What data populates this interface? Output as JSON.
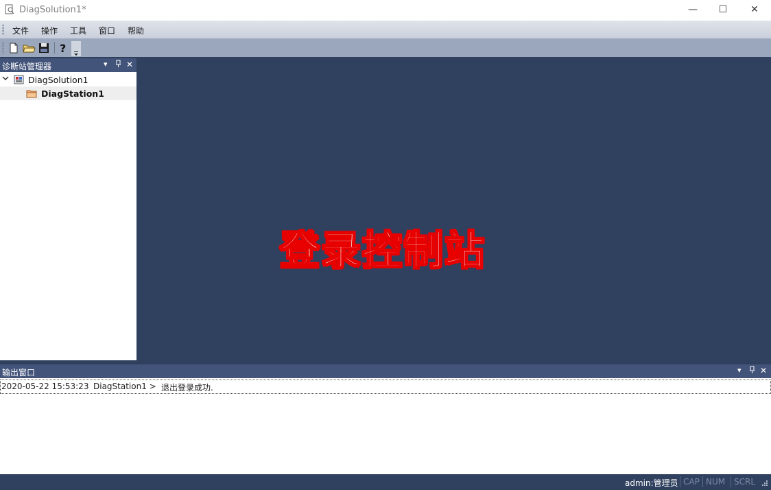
{
  "window": {
    "title": "DiagSolution1*",
    "minimize": "—",
    "maximize": "☐",
    "close": "✕"
  },
  "menu": {
    "items": [
      "文件",
      "操作",
      "工具",
      "窗口",
      "帮助"
    ]
  },
  "left_panel": {
    "title": "诊断站管理器",
    "tree": [
      {
        "label": "DiagSolution1"
      },
      {
        "label": "DiagStation1"
      }
    ]
  },
  "document": {
    "center_text": "登录控制站"
  },
  "output": {
    "title": "输出窗口",
    "rows": [
      {
        "time": "2020-05-22 15:53:23",
        "source": "DiagStation1 >",
        "message": "退出登录成功."
      }
    ]
  },
  "status": {
    "user": "admin:管理员",
    "cap": "CAP",
    "num": "NUM",
    "scrl": "SCRL"
  },
  "colors": {
    "accent": "#43547a",
    "doc_bg": "#30415f",
    "text_stroke": "#e60000"
  }
}
